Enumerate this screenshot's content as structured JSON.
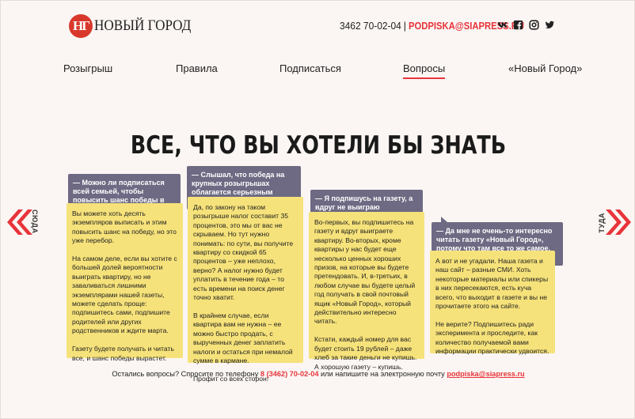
{
  "header": {
    "logo_badge": "НГ",
    "logo_text": "НОВЫЙ ГОРОД",
    "phone": "3462 70-02-04",
    "separator": "|",
    "email": "PODPISKA@SIAPRESS.RU",
    "socials": [
      "vk-icon",
      "facebook-icon",
      "instagram-icon",
      "twitter-icon"
    ]
  },
  "nav": {
    "items": [
      "Розыгрыш",
      "Правила",
      "Подписаться",
      "Вопросы",
      "«Новый Город»"
    ],
    "active": "Вопросы"
  },
  "main": {
    "title": "ВСЕ, ЧТО ВЫ ХОТЕЛИ БЫ ЗНАТЬ",
    "left_label": "СЮДА",
    "right_label": "ТУДА",
    "cards": [
      {
        "question": "— Можно ли подписаться всей семьей, чтобы повысить шанс победы в розыгрыше?",
        "answer": "Вы можете хоть десять экземпляров выписать и этим повысить шанс на победу, но это уже перебор.\n\nНа самом деле, если вы хотите с большей долей вероятности выиграть квартиру, но не заваливаться лишними экземплярами нашей газеты, можете сделать проще: подпишитесь сами, подпишите родителей или других родственников и ждите марта.\n\nГазету будете получать и читать все, и шанс победы вырастет."
      },
      {
        "question": "— Слышал, что победа на крупных розыгрышах облагается серьезным налогом. Это правда?",
        "answer": "Да, по закону на таком розыгрыше налог составит 35 процентов, это мы от вас не скрываем. Но тут нужно понимать: по сути, вы получите квартиру со скидкой 65 процентов – уже неплохо, верно? А налог нужно будет уплатить в течение года – то есть времени на поиск денег точно хватит.\n\nВ крайнем случае, если квартира вам не нужна – ее можно быстро продать, с вырученных денег заплатить налоги и остаться при немалой сумме в кармане.\n\nПрофит со всех сторон!"
      },
      {
        "question": "— Я подпишусь на газету, а вдруг не выиграю квартиру?",
        "answer": "Во-первых, вы подпишитесь на газету и вдруг выиграете квартиру. Во-вторых, кроме квартиры у нас будет еще несколько ценных хороших призов, на которые вы будете претендовать. И, в-третьих, в любом случае вы будете целый год получать в свой почтовый ящик «Новый Город», который действительно интересно читать.\n\nКстати, каждый номер для вас будет стоить 19 рублей – даже хлеб за такие деньги не купишь. А хорошую газету – купишь."
      },
      {
        "question": "— Да мне не очень-то интересно читать газету «Новый Город», потому что там все то же самое, что и на siapress.ru.",
        "answer": "А вот и не угадали. Наша газета и наш сайт – разные СМИ. Хоть некоторые материалы или спикеры в них пересекаются, есть куча всего, что выходит в газете и вы не прочитаете этого на сайте.\n\nНе верите? Подпишитесь ради эксперимента и проследите, как количество получаемой вами информации практически удвоится."
      }
    ]
  },
  "footer": {
    "text_before": "Остались вопросы? Спросите по телефону ",
    "phone": "8 (3462) 70-02-04",
    "text_middle": " или напишите на электронную почту ",
    "email": "podpiska@siapress.ru"
  },
  "colors": {
    "accent": "#e8343b",
    "question_bg": "#6e6a83",
    "answer_bg": "#f6e27a",
    "page_bg": "#fbf6f3"
  }
}
